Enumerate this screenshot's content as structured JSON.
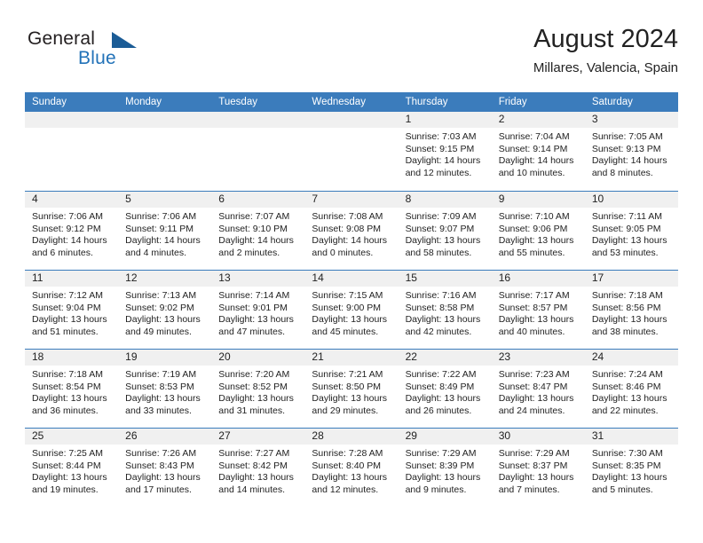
{
  "brand": {
    "name_part1": "General",
    "name_part2": "Blue",
    "logo_icon": "triangle-flag-icon"
  },
  "header": {
    "title": "August 2024",
    "subtitle": "Millares, Valencia, Spain"
  },
  "colors": {
    "header_blue": "#3b7cbc",
    "daynum_band": "#f0f0f0",
    "brand_blue": "#2272b8",
    "text": "#222222"
  },
  "weekdays": [
    "Sunday",
    "Monday",
    "Tuesday",
    "Wednesday",
    "Thursday",
    "Friday",
    "Saturday"
  ],
  "weeks": [
    [
      {
        "day": "",
        "empty": true
      },
      {
        "day": "",
        "empty": true
      },
      {
        "day": "",
        "empty": true
      },
      {
        "day": "",
        "empty": true
      },
      {
        "day": "1",
        "sunrise": "Sunrise: 7:03 AM",
        "sunset": "Sunset: 9:15 PM",
        "daylight1": "Daylight: 14 hours",
        "daylight2": "and 12 minutes."
      },
      {
        "day": "2",
        "sunrise": "Sunrise: 7:04 AM",
        "sunset": "Sunset: 9:14 PM",
        "daylight1": "Daylight: 14 hours",
        "daylight2": "and 10 minutes."
      },
      {
        "day": "3",
        "sunrise": "Sunrise: 7:05 AM",
        "sunset": "Sunset: 9:13 PM",
        "daylight1": "Daylight: 14 hours",
        "daylight2": "and 8 minutes."
      }
    ],
    [
      {
        "day": "4",
        "sunrise": "Sunrise: 7:06 AM",
        "sunset": "Sunset: 9:12 PM",
        "daylight1": "Daylight: 14 hours",
        "daylight2": "and 6 minutes."
      },
      {
        "day": "5",
        "sunrise": "Sunrise: 7:06 AM",
        "sunset": "Sunset: 9:11 PM",
        "daylight1": "Daylight: 14 hours",
        "daylight2": "and 4 minutes."
      },
      {
        "day": "6",
        "sunrise": "Sunrise: 7:07 AM",
        "sunset": "Sunset: 9:10 PM",
        "daylight1": "Daylight: 14 hours",
        "daylight2": "and 2 minutes."
      },
      {
        "day": "7",
        "sunrise": "Sunrise: 7:08 AM",
        "sunset": "Sunset: 9:08 PM",
        "daylight1": "Daylight: 14 hours",
        "daylight2": "and 0 minutes."
      },
      {
        "day": "8",
        "sunrise": "Sunrise: 7:09 AM",
        "sunset": "Sunset: 9:07 PM",
        "daylight1": "Daylight: 13 hours",
        "daylight2": "and 58 minutes."
      },
      {
        "day": "9",
        "sunrise": "Sunrise: 7:10 AM",
        "sunset": "Sunset: 9:06 PM",
        "daylight1": "Daylight: 13 hours",
        "daylight2": "and 55 minutes."
      },
      {
        "day": "10",
        "sunrise": "Sunrise: 7:11 AM",
        "sunset": "Sunset: 9:05 PM",
        "daylight1": "Daylight: 13 hours",
        "daylight2": "and 53 minutes."
      }
    ],
    [
      {
        "day": "11",
        "sunrise": "Sunrise: 7:12 AM",
        "sunset": "Sunset: 9:04 PM",
        "daylight1": "Daylight: 13 hours",
        "daylight2": "and 51 minutes."
      },
      {
        "day": "12",
        "sunrise": "Sunrise: 7:13 AM",
        "sunset": "Sunset: 9:02 PM",
        "daylight1": "Daylight: 13 hours",
        "daylight2": "and 49 minutes."
      },
      {
        "day": "13",
        "sunrise": "Sunrise: 7:14 AM",
        "sunset": "Sunset: 9:01 PM",
        "daylight1": "Daylight: 13 hours",
        "daylight2": "and 47 minutes."
      },
      {
        "day": "14",
        "sunrise": "Sunrise: 7:15 AM",
        "sunset": "Sunset: 9:00 PM",
        "daylight1": "Daylight: 13 hours",
        "daylight2": "and 45 minutes."
      },
      {
        "day": "15",
        "sunrise": "Sunrise: 7:16 AM",
        "sunset": "Sunset: 8:58 PM",
        "daylight1": "Daylight: 13 hours",
        "daylight2": "and 42 minutes."
      },
      {
        "day": "16",
        "sunrise": "Sunrise: 7:17 AM",
        "sunset": "Sunset: 8:57 PM",
        "daylight1": "Daylight: 13 hours",
        "daylight2": "and 40 minutes."
      },
      {
        "day": "17",
        "sunrise": "Sunrise: 7:18 AM",
        "sunset": "Sunset: 8:56 PM",
        "daylight1": "Daylight: 13 hours",
        "daylight2": "and 38 minutes."
      }
    ],
    [
      {
        "day": "18",
        "sunrise": "Sunrise: 7:18 AM",
        "sunset": "Sunset: 8:54 PM",
        "daylight1": "Daylight: 13 hours",
        "daylight2": "and 36 minutes."
      },
      {
        "day": "19",
        "sunrise": "Sunrise: 7:19 AM",
        "sunset": "Sunset: 8:53 PM",
        "daylight1": "Daylight: 13 hours",
        "daylight2": "and 33 minutes."
      },
      {
        "day": "20",
        "sunrise": "Sunrise: 7:20 AM",
        "sunset": "Sunset: 8:52 PM",
        "daylight1": "Daylight: 13 hours",
        "daylight2": "and 31 minutes."
      },
      {
        "day": "21",
        "sunrise": "Sunrise: 7:21 AM",
        "sunset": "Sunset: 8:50 PM",
        "daylight1": "Daylight: 13 hours",
        "daylight2": "and 29 minutes."
      },
      {
        "day": "22",
        "sunrise": "Sunrise: 7:22 AM",
        "sunset": "Sunset: 8:49 PM",
        "daylight1": "Daylight: 13 hours",
        "daylight2": "and 26 minutes."
      },
      {
        "day": "23",
        "sunrise": "Sunrise: 7:23 AM",
        "sunset": "Sunset: 8:47 PM",
        "daylight1": "Daylight: 13 hours",
        "daylight2": "and 24 minutes."
      },
      {
        "day": "24",
        "sunrise": "Sunrise: 7:24 AM",
        "sunset": "Sunset: 8:46 PM",
        "daylight1": "Daylight: 13 hours",
        "daylight2": "and 22 minutes."
      }
    ],
    [
      {
        "day": "25",
        "sunrise": "Sunrise: 7:25 AM",
        "sunset": "Sunset: 8:44 PM",
        "daylight1": "Daylight: 13 hours",
        "daylight2": "and 19 minutes."
      },
      {
        "day": "26",
        "sunrise": "Sunrise: 7:26 AM",
        "sunset": "Sunset: 8:43 PM",
        "daylight1": "Daylight: 13 hours",
        "daylight2": "and 17 minutes."
      },
      {
        "day": "27",
        "sunrise": "Sunrise: 7:27 AM",
        "sunset": "Sunset: 8:42 PM",
        "daylight1": "Daylight: 13 hours",
        "daylight2": "and 14 minutes."
      },
      {
        "day": "28",
        "sunrise": "Sunrise: 7:28 AM",
        "sunset": "Sunset: 8:40 PM",
        "daylight1": "Daylight: 13 hours",
        "daylight2": "and 12 minutes."
      },
      {
        "day": "29",
        "sunrise": "Sunrise: 7:29 AM",
        "sunset": "Sunset: 8:39 PM",
        "daylight1": "Daylight: 13 hours",
        "daylight2": "and 9 minutes."
      },
      {
        "day": "30",
        "sunrise": "Sunrise: 7:29 AM",
        "sunset": "Sunset: 8:37 PM",
        "daylight1": "Daylight: 13 hours",
        "daylight2": "and 7 minutes."
      },
      {
        "day": "31",
        "sunrise": "Sunrise: 7:30 AM",
        "sunset": "Sunset: 8:35 PM",
        "daylight1": "Daylight: 13 hours",
        "daylight2": "and 5 minutes."
      }
    ]
  ]
}
